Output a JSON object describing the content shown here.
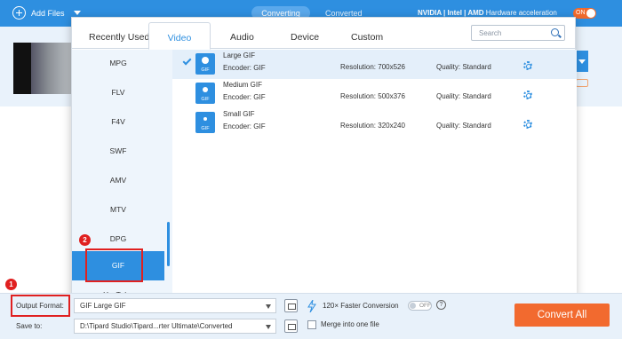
{
  "topbar": {
    "add_files": "Add Files",
    "tab_converting": "Converting",
    "tab_converted": "Converted",
    "hw_brands": "NVIDIA | Intel | AMD",
    "hw_label": "Hardware acceleration",
    "hw_toggle": "ON"
  },
  "panel": {
    "tabs": [
      "Recently Used",
      "Video",
      "Audio",
      "Device",
      "Custom"
    ],
    "search_placeholder": "Search",
    "formats": [
      "MPG",
      "FLV",
      "F4V",
      "SWF",
      "AMV",
      "MTV",
      "DPG",
      "GIF",
      "YouTube"
    ],
    "presets": [
      {
        "name": "Large GIF",
        "encoder": "Encoder: GIF",
        "resolution": "Resolution: 700x526",
        "quality": "Quality: Standard",
        "icon_label": "GIF"
      },
      {
        "name": "Medium GIF",
        "encoder": "Encoder: GIF",
        "resolution": "Resolution: 500x376",
        "quality": "Quality: Standard",
        "icon_label": "GIF"
      },
      {
        "name": "Small GIF",
        "encoder": "Encoder: GIF",
        "resolution": "Resolution: 320x240",
        "quality": "Quality: Standard",
        "icon_label": "GIF"
      }
    ]
  },
  "annotations": {
    "badge1": "1",
    "badge2": "2"
  },
  "bottom": {
    "output_format_label": "Output Format:",
    "output_format_value": "GIF Large GIF",
    "save_to_label": "Save to:",
    "save_to_value": "D:\\Tipard Studio\\Tipard...rter Ultimate\\Converted",
    "faster_conversion": "120× Faster Conversion",
    "faster_toggle": "OFF",
    "help": "?",
    "merge_label": "Merge into one file",
    "convert_all": "Convert All"
  },
  "colors": {
    "accent": "#2e8fe0",
    "convert": "#f26a2f",
    "annotation": "#e02020"
  }
}
